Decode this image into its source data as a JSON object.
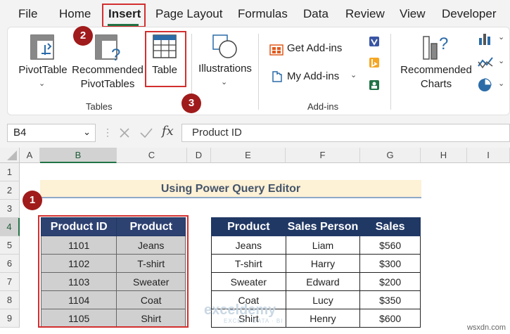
{
  "menu": {
    "items": [
      {
        "label": "File",
        "key": "file"
      },
      {
        "label": "Home",
        "key": "home"
      },
      {
        "label": "Insert",
        "key": "insert",
        "active": true
      },
      {
        "label": "Page Layout",
        "key": "page-layout"
      },
      {
        "label": "Formulas",
        "key": "formulas"
      },
      {
        "label": "Data",
        "key": "data"
      },
      {
        "label": "Review",
        "key": "review"
      },
      {
        "label": "View",
        "key": "view"
      },
      {
        "label": "Developer",
        "key": "developer"
      }
    ]
  },
  "ribbon": {
    "pivot_table": "PivotTable",
    "recommended_pivot_line1": "Recommended",
    "recommended_pivot_line2": "PivotTables",
    "table": "Table",
    "illustrations": "Illustrations",
    "get_addins": "Get Add-ins",
    "my_addins": "My Add-ins",
    "recommended_charts_line1": "Recommended",
    "recommended_charts_line2": "Charts",
    "group_tables": "Tables",
    "group_addins": "Add-ins"
  },
  "badges": {
    "b1": "1",
    "b2": "2",
    "b3": "3"
  },
  "formula_bar": {
    "name_box": "B4",
    "fx": "fx",
    "formula": "Product ID"
  },
  "columns": [
    "A",
    "B",
    "C",
    "D",
    "E",
    "F",
    "G",
    "H",
    "I"
  ],
  "rows": [
    "1",
    "2",
    "3",
    "4",
    "5",
    "6",
    "7",
    "8",
    "9"
  ],
  "banner": "Using Power Query Editor",
  "table1": {
    "headers": [
      "Product ID",
      "Product"
    ],
    "rows": [
      [
        "1101",
        "Jeans"
      ],
      [
        "1102",
        "T-shirt"
      ],
      [
        "1103",
        "Sweater"
      ],
      [
        "1104",
        "Coat"
      ],
      [
        "1105",
        "Shirt"
      ]
    ]
  },
  "table2": {
    "headers": [
      "Product",
      "Sales Person",
      "Sales"
    ],
    "rows": [
      [
        "Jeans",
        "Liam",
        "$560"
      ],
      [
        "T-shirt",
        "Harry",
        "$300"
      ],
      [
        "Sweater",
        "Edward",
        "$200"
      ],
      [
        "Coat",
        "Lucy",
        "$350"
      ],
      [
        "Shirt",
        "Henry",
        "$600"
      ]
    ]
  },
  "watermark": {
    "name": "exceldemy",
    "tagline": "EXCEL · DATA · BI"
  },
  "credit": "wsxdn.com",
  "colors": {
    "accent_green": "#217346",
    "header_navy": "#203864",
    "badge_red": "#a01b1b",
    "highlight_red": "#d32f2f"
  }
}
